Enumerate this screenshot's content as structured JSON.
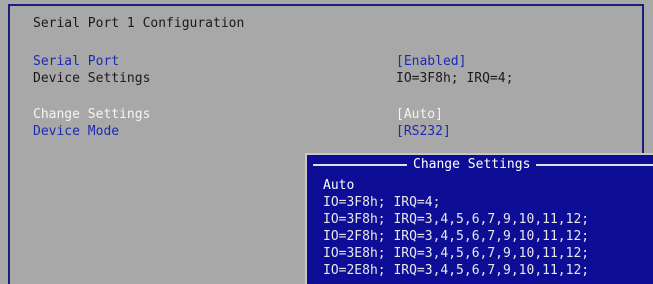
{
  "screen": {
    "title": "Serial Port 1 Configuration",
    "rows": [
      {
        "label": "Serial Port",
        "value": "[Enabled]"
      },
      {
        "label": "Device Settings",
        "value": "IO=3F8h; IRQ=4;"
      },
      {
        "label": "Change Settings",
        "value": "[Auto]"
      },
      {
        "label": "Device Mode",
        "value": "[RS232]"
      }
    ]
  },
  "popup": {
    "title": "Change Settings",
    "options": [
      "Auto",
      "IO=3F8h; IRQ=4;",
      "IO=3F8h; IRQ=3,4,5,6,7,9,10,11,12;",
      "IO=2F8h; IRQ=3,4,5,6,7,9,10,11,12;",
      "IO=3E8h; IRQ=3,4,5,6,7,9,10,11,12;",
      "IO=2E8h; IRQ=3,4,5,6,7,9,10,11,12;"
    ],
    "selected_option": "Auto"
  },
  "colors": {
    "background": "#a8a8a8",
    "link_blue": "#1c2bb0",
    "popup_blue": "#0d0d96",
    "highlight_white": "#f4f4f4"
  }
}
